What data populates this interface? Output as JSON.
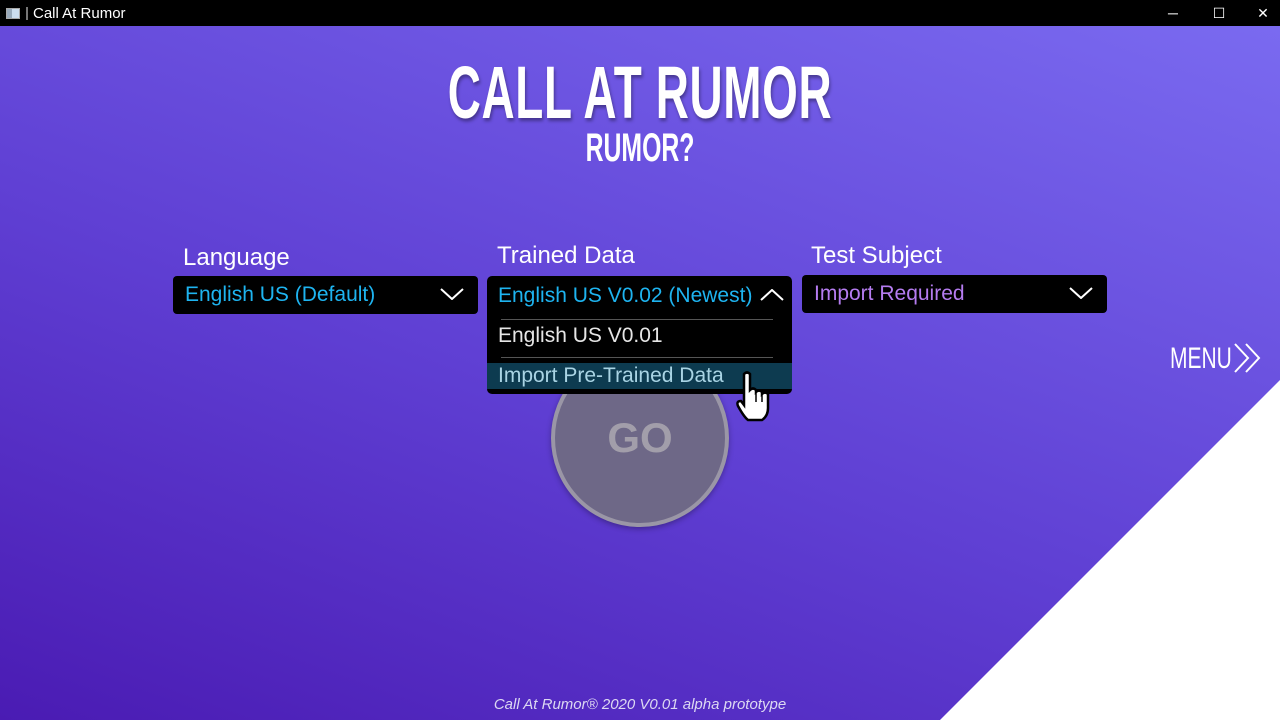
{
  "window": {
    "title": "Call At Rumor",
    "controls": {
      "minimize": "─",
      "maximize": "☐",
      "close": "✕"
    }
  },
  "header": {
    "title": "CALL AT RUMOR",
    "subtitle": "RUMOR?"
  },
  "language": {
    "label": "Language",
    "value": "English US (Default)"
  },
  "trained_data": {
    "label": "Trained Data",
    "value": "English US V0.02 (Newest)",
    "options": [
      "English US V0.01",
      "Import Pre-Trained Data"
    ],
    "highlighted": "Import Pre-Trained Data"
  },
  "test_subject": {
    "label": "Test Subject",
    "value": "Import Required"
  },
  "menu": {
    "label": "MENU"
  },
  "go": {
    "label": "GO"
  },
  "footer": "Call At Rumor® 2020 V0.01 alpha prototype",
  "colors": {
    "accent": "#1eb4f0",
    "warning": "#b57cf0",
    "highlight": "#0d3b50"
  }
}
